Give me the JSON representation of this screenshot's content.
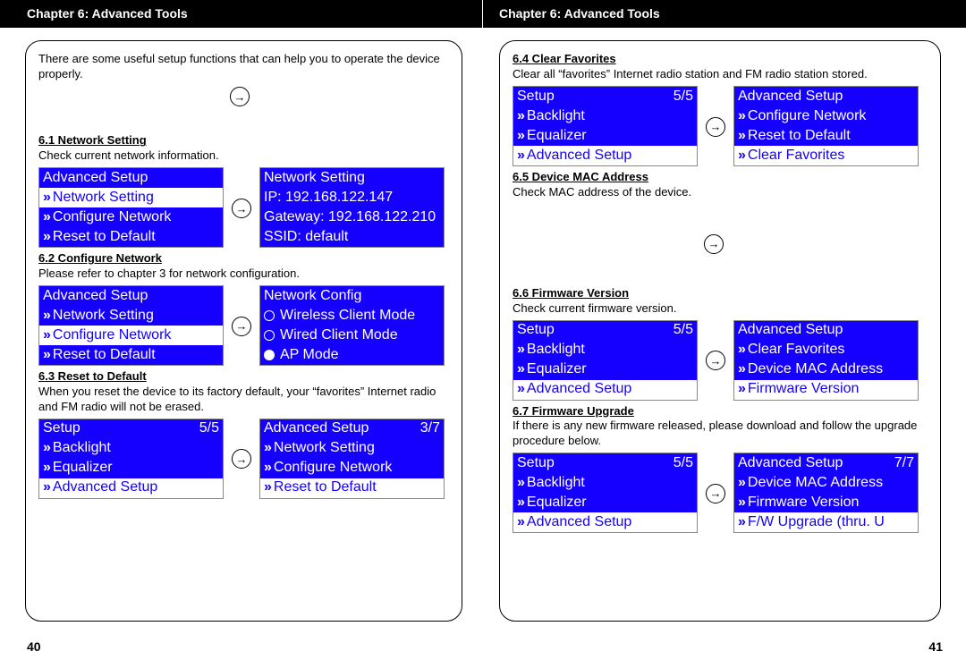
{
  "pageLeft": {
    "header": "Chapter 6: Advanced Tools",
    "pageNum": "40",
    "intro": "There are some useful setup functions that can help you to operate the device properly.",
    "s61": {
      "title": "6.1 Network Setting",
      "desc": "Check current network information."
    },
    "s62": {
      "title": "6.2 Configure Network",
      "desc": "Please refer to chapter 3 for network configuration."
    },
    "s63": {
      "title": "6.3 Reset to Default",
      "desc": "When you reset the device to its factory default, your “favorites” Internet radio and FM radio will not be erased."
    },
    "scr61a": {
      "r1": "Advanced Setup",
      "r2": "Network Setting",
      "r3": "Configure Network",
      "r4": "Reset to Default"
    },
    "scr61b": {
      "r1": "Network Setting",
      "r2": "IP: 192.168.122.147",
      "r3": "Gateway: 192.168.122.210",
      "r4": "SSID: default"
    },
    "scr62a": {
      "r1": "Advanced Setup",
      "r2": "Network Setting",
      "r3": "Configure Network",
      "r4": "Reset to Default"
    },
    "scr62b": {
      "r1": "Network Config",
      "r2": "Wireless Client Mode",
      "r3": "Wired Client Mode",
      "r4": "AP Mode"
    },
    "scr63a": {
      "t": "Setup",
      "p": "5/5",
      "r2": "Backlight",
      "r3": "Equalizer",
      "r4": "Advanced Setup"
    },
    "scr63b": {
      "t": "Advanced Setup",
      "p": "3/7",
      "r2": "Network Setting",
      "r3": "Configure Network",
      "r4": "Reset to Default"
    }
  },
  "pageRight": {
    "header": "Chapter 6: Advanced Tools",
    "pageNum": "41",
    "s64": {
      "title": "6.4 Clear Favorites",
      "desc": "Clear all “favorites” Internet radio station and FM radio station stored."
    },
    "s65": {
      "title": "6.5 Device MAC Address",
      "desc": "Check MAC address of the device."
    },
    "s66": {
      "title": "6.6 Firmware Version",
      "desc": "Check current firmware version."
    },
    "s67": {
      "title": "6.7 Firmware Upgrade",
      "desc": "If there is any new firmware released, please download and follow the upgrade procedure below."
    },
    "scr64a": {
      "t": "Setup",
      "p": "5/5",
      "r2": "Backlight",
      "r3": "Equalizer",
      "r4": "Advanced Setup"
    },
    "scr64b": {
      "r1": "Advanced Setup",
      "r2": "Configure Network",
      "r3": "Reset to Default",
      "r4": "Clear Favorites"
    },
    "scr66a": {
      "t": "Setup",
      "p": "5/5",
      "r2": "Backlight",
      "r3": "Equalizer",
      "r4": "Advanced Setup"
    },
    "scr66b": {
      "r1": "Advanced Setup",
      "r2": "Clear Favorites",
      "r3": "Device MAC Address",
      "r4": "Firmware Version"
    },
    "scr67a": {
      "t": "Setup",
      "p": "5/5",
      "r2": "Backlight",
      "r3": "Equalizer",
      "r4": "Advanced Setup"
    },
    "scr67b": {
      "t": "Advanced Setup",
      "p": "7/7",
      "r2": "Device MAC Address",
      "r3": "Firmware Version",
      "r4": "F/W Upgrade (thru. U"
    }
  }
}
